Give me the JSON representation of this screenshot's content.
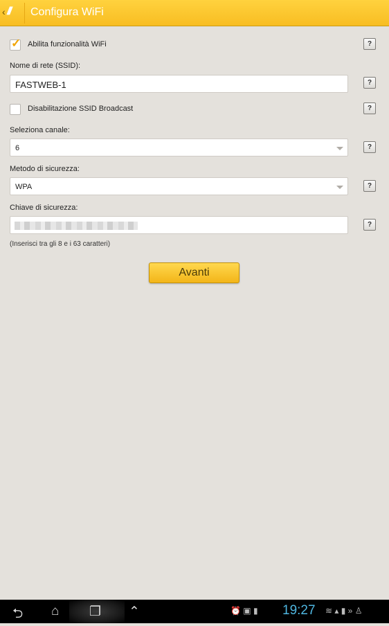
{
  "header": {
    "back": "‹",
    "logo": "///",
    "title": "Configura WiFi"
  },
  "form": {
    "enable_wifi": {
      "label": "Abilita funzionalità WiFi",
      "checked": true
    },
    "ssid": {
      "label": "Nome di rete (SSID):",
      "value": "FASTWEB-1"
    },
    "disable_broadcast": {
      "label": "Disabilitazione SSID Broadcast",
      "checked": false
    },
    "channel": {
      "label": "Seleziona canale:",
      "value": "6"
    },
    "security": {
      "label": "Metodo di sicurezza:",
      "value": "WPA"
    },
    "key": {
      "label": "Chiave di sicurezza:",
      "hint": "(Inserisci tra gli 8 e i 63 caratteri)"
    },
    "help_label": "?",
    "next_button": "Avanti"
  },
  "system_bar": {
    "back_icon": "⮌",
    "home_icon": "⌂",
    "recent_icon": "❐",
    "menu_icon": "⌃",
    "status_icons": "⏰ ▣ ▮",
    "clock": "19:27",
    "signal_icons": "≋ ▴ ▮ » ♙"
  },
  "colors": {
    "accent": "#f8bd22",
    "clock": "#4fb6e0",
    "background": "#e4e1dc"
  }
}
